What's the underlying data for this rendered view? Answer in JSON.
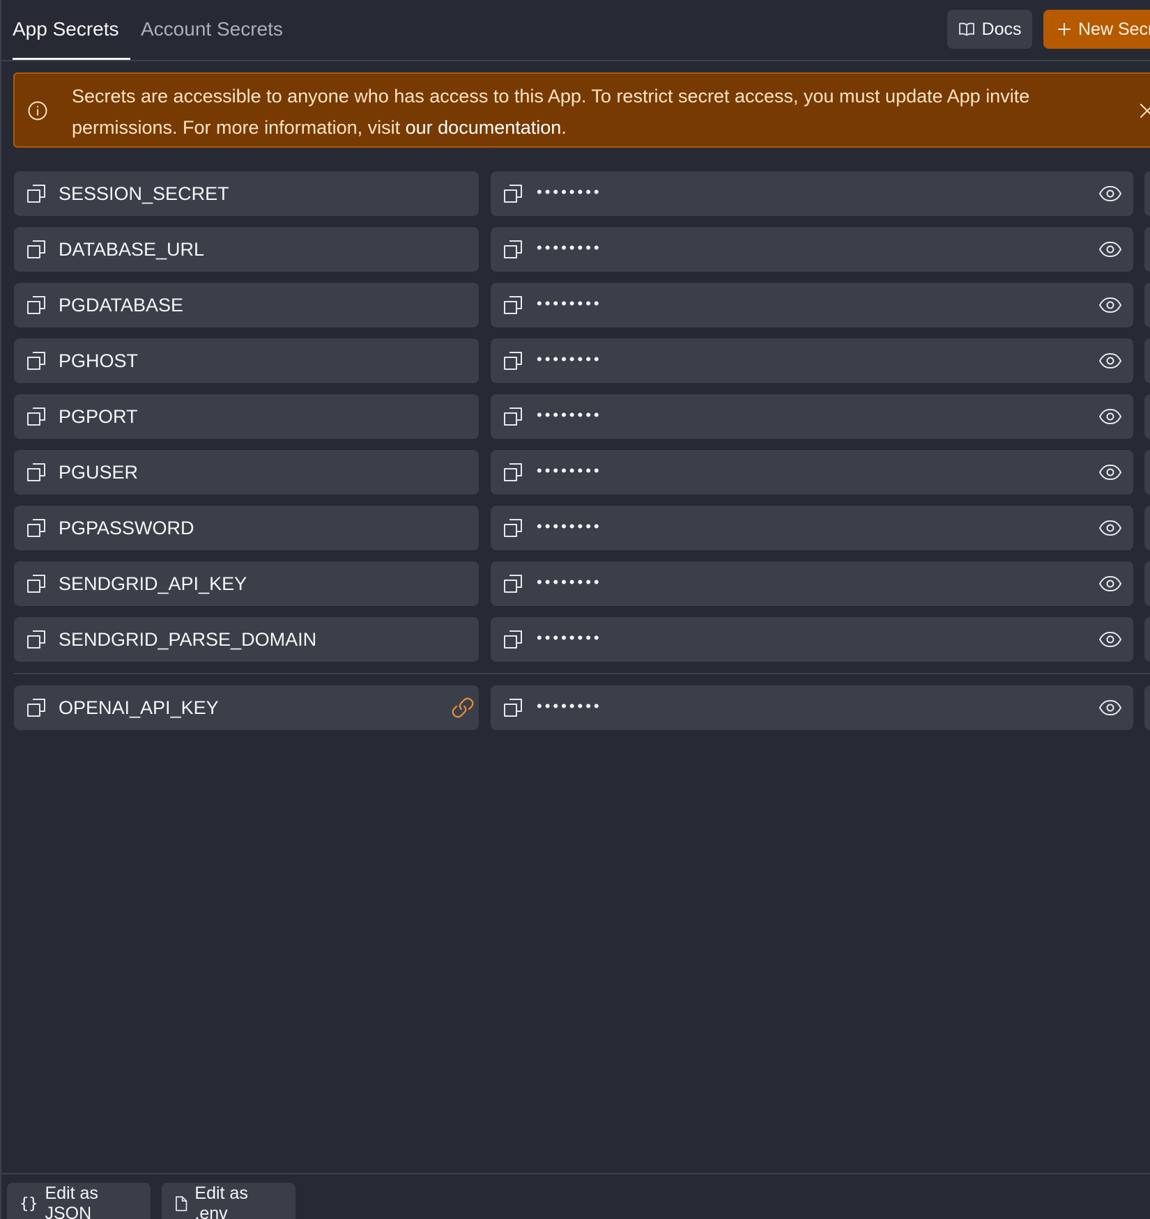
{
  "header": {
    "tabs": [
      {
        "label": "App Secrets",
        "active": true
      },
      {
        "label": "Account Secrets",
        "active": false
      }
    ],
    "docs_button": {
      "label": "Docs",
      "icon": "book-open-icon"
    },
    "new_secret_button": {
      "label": "New Secret",
      "icon": "plus-icon"
    }
  },
  "banner": {
    "icon": "info-circle-icon",
    "text": "Secrets are accessible to anyone who has access to this App. To restrict secret access, you must update App invite permissions. For more information, visit ",
    "link_text": "our documentation",
    "text_end": ".",
    "close_icon": "close-icon"
  },
  "secrets": [
    {
      "key": "SESSION_SECRET",
      "value_masked": "••••••••",
      "linked": false
    },
    {
      "key": "DATABASE_URL",
      "value_masked": "••••••••",
      "linked": false
    },
    {
      "key": "PGDATABASE",
      "value_masked": "••••••••",
      "linked": false
    },
    {
      "key": "PGHOST",
      "value_masked": "••••••••",
      "linked": false
    },
    {
      "key": "PGPORT",
      "value_masked": "••••••••",
      "linked": false
    },
    {
      "key": "PGUSER",
      "value_masked": "••••••••",
      "linked": false
    },
    {
      "key": "PGPASSWORD",
      "value_masked": "••••••••",
      "linked": false
    },
    {
      "key": "SENDGRID_API_KEY",
      "value_masked": "••••••••",
      "linked": false
    },
    {
      "key": "SENDGRID_PARSE_DOMAIN",
      "value_masked": "••••••••",
      "linked": false
    },
    {
      "key": "OPENAI_API_KEY",
      "value_masked": "••••••••",
      "linked": true
    }
  ],
  "footer": {
    "edit_json_label": "Edit as JSON",
    "edit_env_label": "Edit as .env"
  },
  "colors": {
    "background": "#272a34",
    "surface": "#3b3f4a",
    "banner_bg": "#773a02",
    "banner_border": "#b05b0a",
    "accent": "#b65a00",
    "link_icon": "#e8903a"
  }
}
